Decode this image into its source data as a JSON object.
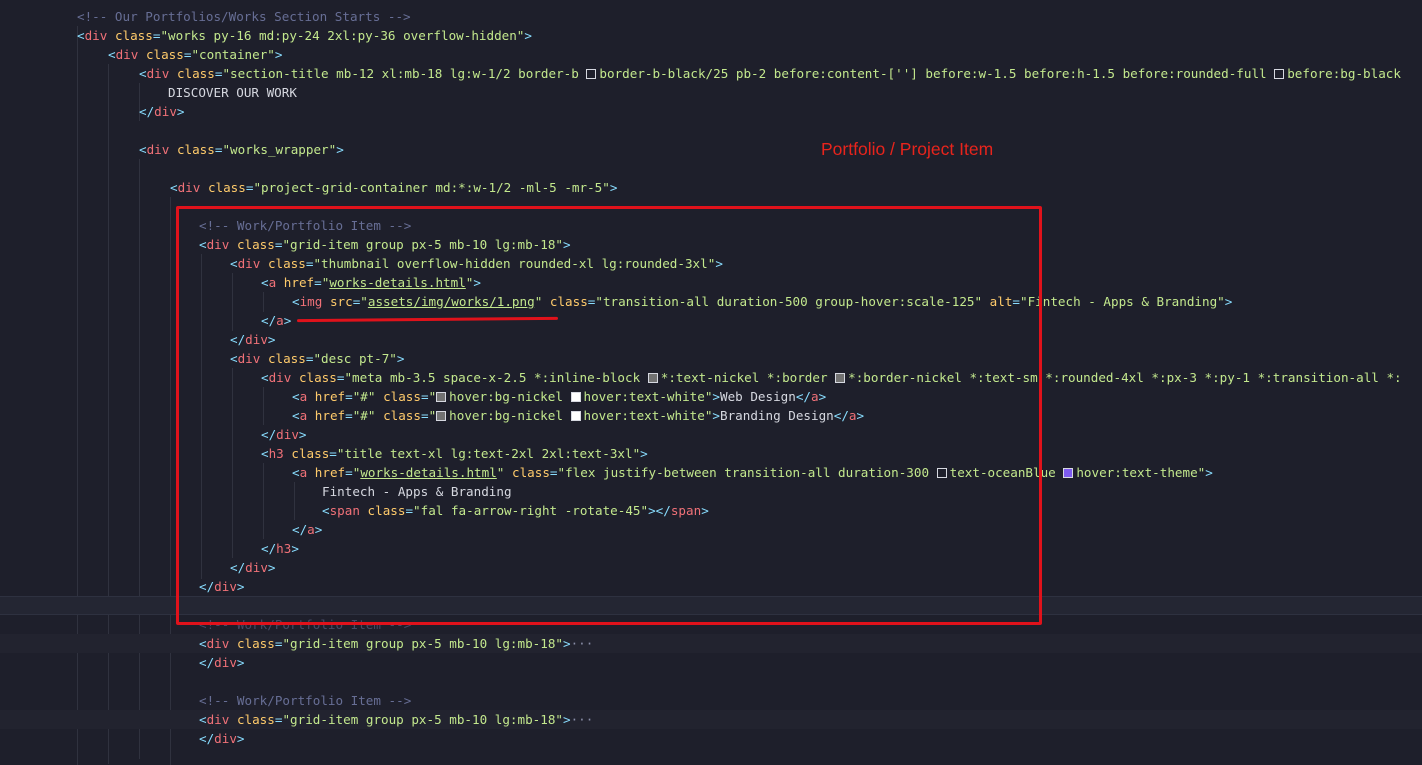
{
  "annotation": {
    "label": "Portfolio / Project Item",
    "color": "#e0121b"
  },
  "swatch_colors": {
    "black_25": "#000000",
    "black": "#000000",
    "nickel": "#727272",
    "white": "#ffffff",
    "oceanBlue": "#1e1f2b",
    "theme": "#7e5bef"
  },
  "lines": [
    "<!-- Our Portfolios/Works Section Starts -->",
    "<div class=\"works py-16 md:py-24 2xl:py-36 overflow-hidden\">",
    "<div class=\"container\">",
    "<div class=\"section-title mb-12 xl:mb-18 lg:w-1/2 border-b ",
    "border-b-black/25 pb-2 before:content-[''] before:w-1.5 before:h-1.5 before:rounded-full ",
    "before:bg-black",
    "DISCOVER OUR WORK",
    "</div>",
    "<div class=\"works_wrapper\">",
    "<div class=\"project-grid-container md:*:w-1/2 -ml-5 -mr-5\">",
    "<!-- Work/Portfolio Item -->",
    "<div class=\"grid-item group px-5 mb-10 lg:mb-18\">",
    "<div class=\"thumbnail overflow-hidden rounded-xl lg:rounded-3xl\">",
    "<a href=\"works-details.html\">",
    "<img src=\"assets/img/works/1.png\" class=\"transition-all duration-500 group-hover:scale-125\" alt=\"Fintech - Apps & Branding\">",
    "</a>",
    "</div>",
    "<div class=\"desc pt-7\">",
    "<div class=\"meta mb-3.5 space-x-2.5 *:inline-block ",
    "*:text-nickel *:border ",
    "*:border-nickel *:text-sm *:rounded-4xl *:px-3 *:py-1 *:transition-all *:",
    "<a href=\"#\" class=\"",
    "hover:bg-nickel ",
    "hover:text-white\">Web Design</a>",
    "hover:text-white\">Branding Design</a>",
    "</div>",
    "<h3 class=\"title text-xl lg:text-2xl 2xl:text-3xl\">",
    "<a href=\"works-details.html\" class=\"flex justify-between transition-all duration-300 ",
    "text-oceanBlue ",
    "hover:text-theme\">",
    "Fintech - Apps & Branding",
    "<span class=\"fal fa-arrow-right -rotate-45\"></span>",
    "</a>",
    "</h3>",
    "<!-- Work/Portfolio Item -->",
    "<div class=\"grid-item group px-5 mb-10 lg:mb-18\">",
    "···"
  ]
}
